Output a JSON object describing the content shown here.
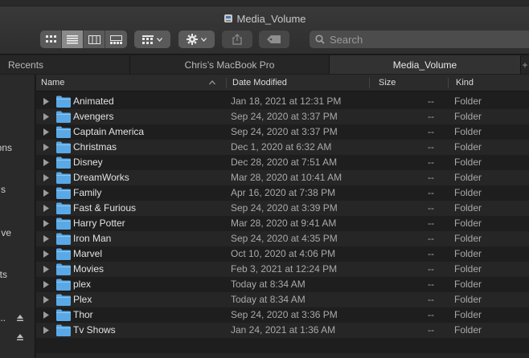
{
  "window": {
    "title": "Media_Volume"
  },
  "toolbar": {
    "view_buttons": [
      "icon-view",
      "list-view",
      "column-view",
      "gallery-view"
    ],
    "active_view": "list-view",
    "search_placeholder": "Search"
  },
  "tabs": [
    {
      "label": "Recents"
    },
    {
      "label": "Chris’s MacBook Pro"
    },
    {
      "label": "Media_Volume",
      "active": true
    }
  ],
  "sidebar": {
    "items": [
      "ons",
      "s",
      "ve",
      "ts",
      "..."
    ]
  },
  "columns": {
    "name": "Name",
    "date": "Date Modified",
    "size": "Size",
    "kind": "Kind"
  },
  "rows": [
    {
      "name": "Animated",
      "date": "Jan 18, 2021 at 12:31 PM",
      "size": "--",
      "kind": "Folder"
    },
    {
      "name": "Avengers",
      "date": "Sep 24, 2020 at 3:37 PM",
      "size": "--",
      "kind": "Folder"
    },
    {
      "name": "Captain America",
      "date": "Sep 24, 2020 at 3:37 PM",
      "size": "--",
      "kind": "Folder"
    },
    {
      "name": "Christmas",
      "date": "Dec 1, 2020 at 6:32 AM",
      "size": "--",
      "kind": "Folder"
    },
    {
      "name": "Disney",
      "date": "Dec 28, 2020 at 7:51 AM",
      "size": "--",
      "kind": "Folder"
    },
    {
      "name": "DreamWorks",
      "date": "Mar 28, 2020 at 10:41 AM",
      "size": "--",
      "kind": "Folder"
    },
    {
      "name": "Family",
      "date": "Apr 16, 2020 at 7:38 PM",
      "size": "--",
      "kind": "Folder"
    },
    {
      "name": "Fast & Furious",
      "date": "Sep 24, 2020 at 3:39 PM",
      "size": "--",
      "kind": "Folder"
    },
    {
      "name": "Harry Potter",
      "date": "Mar 28, 2020 at 9:41 AM",
      "size": "--",
      "kind": "Folder"
    },
    {
      "name": "Iron Man",
      "date": "Sep 24, 2020 at 4:35 PM",
      "size": "--",
      "kind": "Folder"
    },
    {
      "name": "Marvel",
      "date": "Oct 10, 2020 at 4:06 PM",
      "size": "--",
      "kind": "Folder"
    },
    {
      "name": "Movies",
      "date": "Feb 3, 2021 at 12:24 PM",
      "size": "--",
      "kind": "Folder"
    },
    {
      "name": "plex",
      "date": "Today at 8:34 AM",
      "size": "--",
      "kind": "Folder"
    },
    {
      "name": "Plex",
      "date": "Today at 8:34 AM",
      "size": "--",
      "kind": "Folder"
    },
    {
      "name": "Thor",
      "date": "Sep 24, 2020 at 3:36 PM",
      "size": "--",
      "kind": "Folder"
    },
    {
      "name": "Tv Shows",
      "date": "Jan 24, 2021 at 1:36 AM",
      "size": "--",
      "kind": "Folder"
    }
  ],
  "colors": {
    "folder": "#5aa9e6",
    "background": "#1e1e1e",
    "alt_row": "#262626"
  }
}
